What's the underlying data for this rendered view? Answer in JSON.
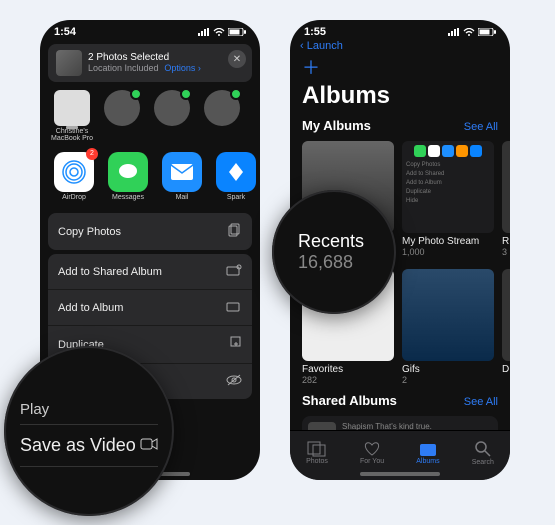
{
  "left": {
    "time": "1:54",
    "share_title": "2 Photos Selected",
    "share_sub": "Location Included",
    "share_options": "Options ›",
    "contacts": [
      {
        "name": "Christine's MacBook Pro"
      },
      {
        "name": ""
      },
      {
        "name": ""
      },
      {
        "name": ""
      }
    ],
    "apps": {
      "airdrop": "AirDrop",
      "messages": "Messages",
      "mail": "Mail",
      "spark": "Spark",
      "messages_badge": "2"
    },
    "actions": {
      "copy": "Copy Photos",
      "shared_album": "Add to Shared Album",
      "album": "Add to Album",
      "duplicate": "Duplicate",
      "hide": "Hide"
    }
  },
  "right": {
    "time": "1:55",
    "back": "‹ Launch",
    "title": "Albums",
    "section_my": "My Albums",
    "see_all": "See All",
    "albums": [
      {
        "name": "Recents",
        "count": "16,688"
      },
      {
        "name": "My Photo Stream",
        "count": "1,000"
      },
      {
        "name": "R",
        "count": "3"
      }
    ],
    "albums2": [
      {
        "name": "Favorites",
        "count": "282"
      },
      {
        "name": "Gifs",
        "count": "2"
      },
      {
        "name": "D",
        "count": ""
      }
    ],
    "section_shared": "Shared Albums",
    "tabs": {
      "photos": "Photos",
      "foryou": "For You",
      "albums": "Albums",
      "search": "Search"
    }
  },
  "callout1": {
    "play": "Play",
    "save": "Save as Video"
  },
  "callout2": {
    "name": "Recents",
    "count": "16,688"
  }
}
